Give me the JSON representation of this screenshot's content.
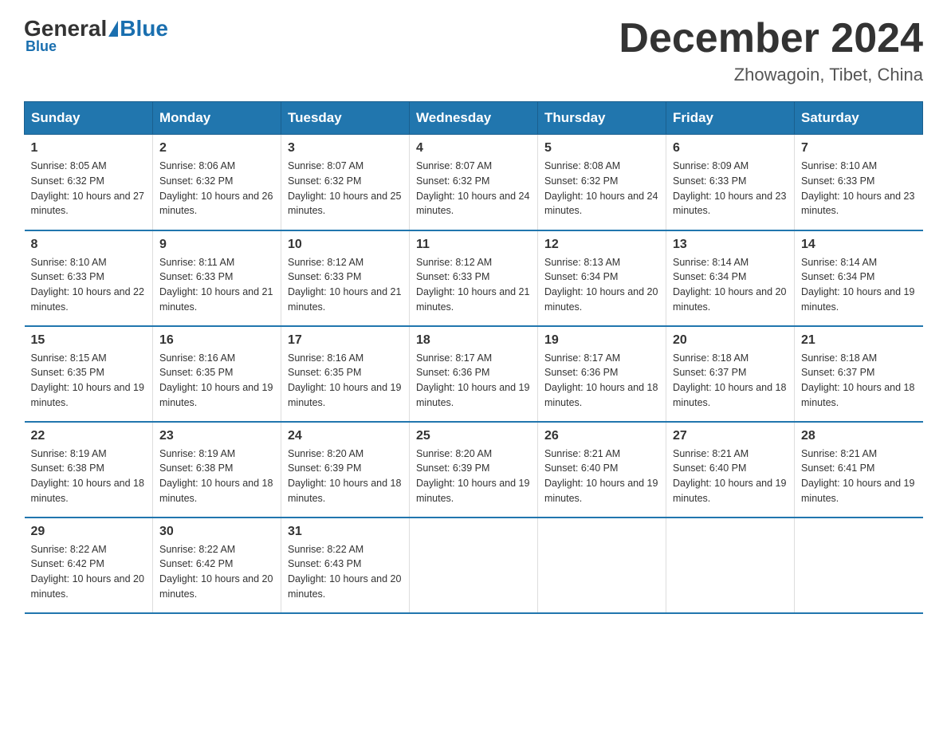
{
  "header": {
    "logo_general": "General",
    "logo_blue": "Blue",
    "month_title": "December 2024",
    "subtitle": "Zhowagoin, Tibet, China"
  },
  "days_of_week": [
    "Sunday",
    "Monday",
    "Tuesday",
    "Wednesday",
    "Thursday",
    "Friday",
    "Saturday"
  ],
  "weeks": [
    [
      {
        "num": "1",
        "sunrise": "8:05 AM",
        "sunset": "6:32 PM",
        "daylight": "10 hours and 27 minutes."
      },
      {
        "num": "2",
        "sunrise": "8:06 AM",
        "sunset": "6:32 PM",
        "daylight": "10 hours and 26 minutes."
      },
      {
        "num": "3",
        "sunrise": "8:07 AM",
        "sunset": "6:32 PM",
        "daylight": "10 hours and 25 minutes."
      },
      {
        "num": "4",
        "sunrise": "8:07 AM",
        "sunset": "6:32 PM",
        "daylight": "10 hours and 24 minutes."
      },
      {
        "num": "5",
        "sunrise": "8:08 AM",
        "sunset": "6:32 PM",
        "daylight": "10 hours and 24 minutes."
      },
      {
        "num": "6",
        "sunrise": "8:09 AM",
        "sunset": "6:33 PM",
        "daylight": "10 hours and 23 minutes."
      },
      {
        "num": "7",
        "sunrise": "8:10 AM",
        "sunset": "6:33 PM",
        "daylight": "10 hours and 23 minutes."
      }
    ],
    [
      {
        "num": "8",
        "sunrise": "8:10 AM",
        "sunset": "6:33 PM",
        "daylight": "10 hours and 22 minutes."
      },
      {
        "num": "9",
        "sunrise": "8:11 AM",
        "sunset": "6:33 PM",
        "daylight": "10 hours and 21 minutes."
      },
      {
        "num": "10",
        "sunrise": "8:12 AM",
        "sunset": "6:33 PM",
        "daylight": "10 hours and 21 minutes."
      },
      {
        "num": "11",
        "sunrise": "8:12 AM",
        "sunset": "6:33 PM",
        "daylight": "10 hours and 21 minutes."
      },
      {
        "num": "12",
        "sunrise": "8:13 AM",
        "sunset": "6:34 PM",
        "daylight": "10 hours and 20 minutes."
      },
      {
        "num": "13",
        "sunrise": "8:14 AM",
        "sunset": "6:34 PM",
        "daylight": "10 hours and 20 minutes."
      },
      {
        "num": "14",
        "sunrise": "8:14 AM",
        "sunset": "6:34 PM",
        "daylight": "10 hours and 19 minutes."
      }
    ],
    [
      {
        "num": "15",
        "sunrise": "8:15 AM",
        "sunset": "6:35 PM",
        "daylight": "10 hours and 19 minutes."
      },
      {
        "num": "16",
        "sunrise": "8:16 AM",
        "sunset": "6:35 PM",
        "daylight": "10 hours and 19 minutes."
      },
      {
        "num": "17",
        "sunrise": "8:16 AM",
        "sunset": "6:35 PM",
        "daylight": "10 hours and 19 minutes."
      },
      {
        "num": "18",
        "sunrise": "8:17 AM",
        "sunset": "6:36 PM",
        "daylight": "10 hours and 19 minutes."
      },
      {
        "num": "19",
        "sunrise": "8:17 AM",
        "sunset": "6:36 PM",
        "daylight": "10 hours and 18 minutes."
      },
      {
        "num": "20",
        "sunrise": "8:18 AM",
        "sunset": "6:37 PM",
        "daylight": "10 hours and 18 minutes."
      },
      {
        "num": "21",
        "sunrise": "8:18 AM",
        "sunset": "6:37 PM",
        "daylight": "10 hours and 18 minutes."
      }
    ],
    [
      {
        "num": "22",
        "sunrise": "8:19 AM",
        "sunset": "6:38 PM",
        "daylight": "10 hours and 18 minutes."
      },
      {
        "num": "23",
        "sunrise": "8:19 AM",
        "sunset": "6:38 PM",
        "daylight": "10 hours and 18 minutes."
      },
      {
        "num": "24",
        "sunrise": "8:20 AM",
        "sunset": "6:39 PM",
        "daylight": "10 hours and 18 minutes."
      },
      {
        "num": "25",
        "sunrise": "8:20 AM",
        "sunset": "6:39 PM",
        "daylight": "10 hours and 19 minutes."
      },
      {
        "num": "26",
        "sunrise": "8:21 AM",
        "sunset": "6:40 PM",
        "daylight": "10 hours and 19 minutes."
      },
      {
        "num": "27",
        "sunrise": "8:21 AM",
        "sunset": "6:40 PM",
        "daylight": "10 hours and 19 minutes."
      },
      {
        "num": "28",
        "sunrise": "8:21 AM",
        "sunset": "6:41 PM",
        "daylight": "10 hours and 19 minutes."
      }
    ],
    [
      {
        "num": "29",
        "sunrise": "8:22 AM",
        "sunset": "6:42 PM",
        "daylight": "10 hours and 20 minutes."
      },
      {
        "num": "30",
        "sunrise": "8:22 AM",
        "sunset": "6:42 PM",
        "daylight": "10 hours and 20 minutes."
      },
      {
        "num": "31",
        "sunrise": "8:22 AM",
        "sunset": "6:43 PM",
        "daylight": "10 hours and 20 minutes."
      },
      null,
      null,
      null,
      null
    ]
  ],
  "labels": {
    "sunrise": "Sunrise:",
    "sunset": "Sunset:",
    "daylight": "Daylight:"
  }
}
